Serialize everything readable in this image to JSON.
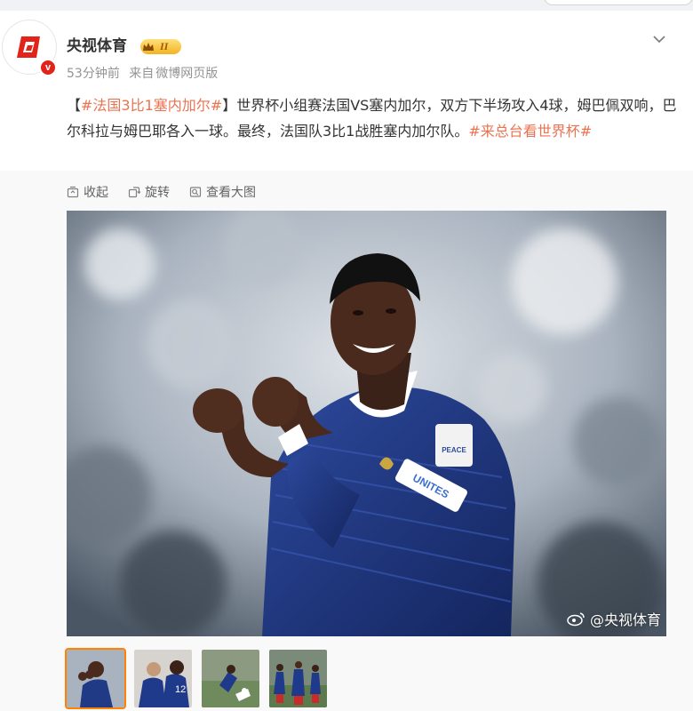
{
  "post": {
    "author": "央视体育",
    "rank_level": "II",
    "verified_mark": "v",
    "time": "53分钟前",
    "source_prefix": "来自",
    "source": "微博网页版",
    "text": {
      "topic1": "#法国3比1塞内加尔#",
      "bracket_open": "【",
      "bracket_close": "】",
      "body": "世界杯小组赛法国VS塞内加尔，双方下半场攻入4球，姆巴佩双响，巴尔科拉与姆巴耶各入一球。最终，法国队3比1战胜塞内加尔队。",
      "topic2": "#来总台看世界杯#"
    }
  },
  "actions": {
    "collapse": "收起",
    "rotate": "旋转",
    "view_large": "查看大图"
  },
  "photo": {
    "watermark": "@央视体育",
    "captain_band": "UNITES",
    "peace_patch": "PEACE"
  },
  "thumbnails": [
    {
      "name": "thumb-1",
      "active": true
    },
    {
      "name": "thumb-2",
      "active": false
    },
    {
      "name": "thumb-3",
      "active": false
    },
    {
      "name": "thumb-4",
      "active": false
    }
  ],
  "colors": {
    "topic": "#eb7350",
    "verified": "#e2231a",
    "active_thumb_border": "#ff8200",
    "muted_text": "#939393"
  }
}
